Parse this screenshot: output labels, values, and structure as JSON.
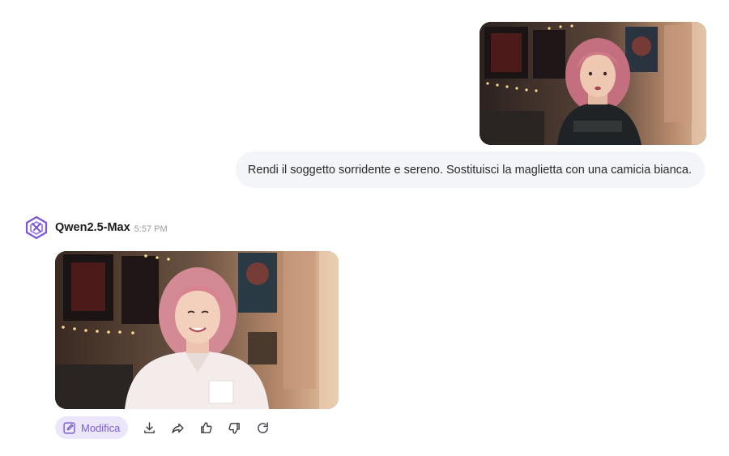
{
  "user_message": {
    "image_icon": "photo-portrait-serious",
    "text": "Rendi il soggetto sorridente e sereno. Sostituisci la maglietta con una camicia bianca."
  },
  "assistant": {
    "model_name": "Qwen2.5-Max",
    "timestamp": "5:57 PM",
    "logo_icon": "qwen-logo-icon",
    "image_icon": "photo-portrait-smiling",
    "actions": {
      "edit_label": "Modifica",
      "icons": [
        "pencil-edit-icon",
        "download-icon",
        "share-icon",
        "thumbs-up-icon",
        "thumbs-down-icon",
        "regenerate-icon"
      ]
    }
  },
  "colors": {
    "accent": "#7b5cd6",
    "accent_bg": "#ece6fb",
    "bubble_bg": "#f4f5f9"
  }
}
